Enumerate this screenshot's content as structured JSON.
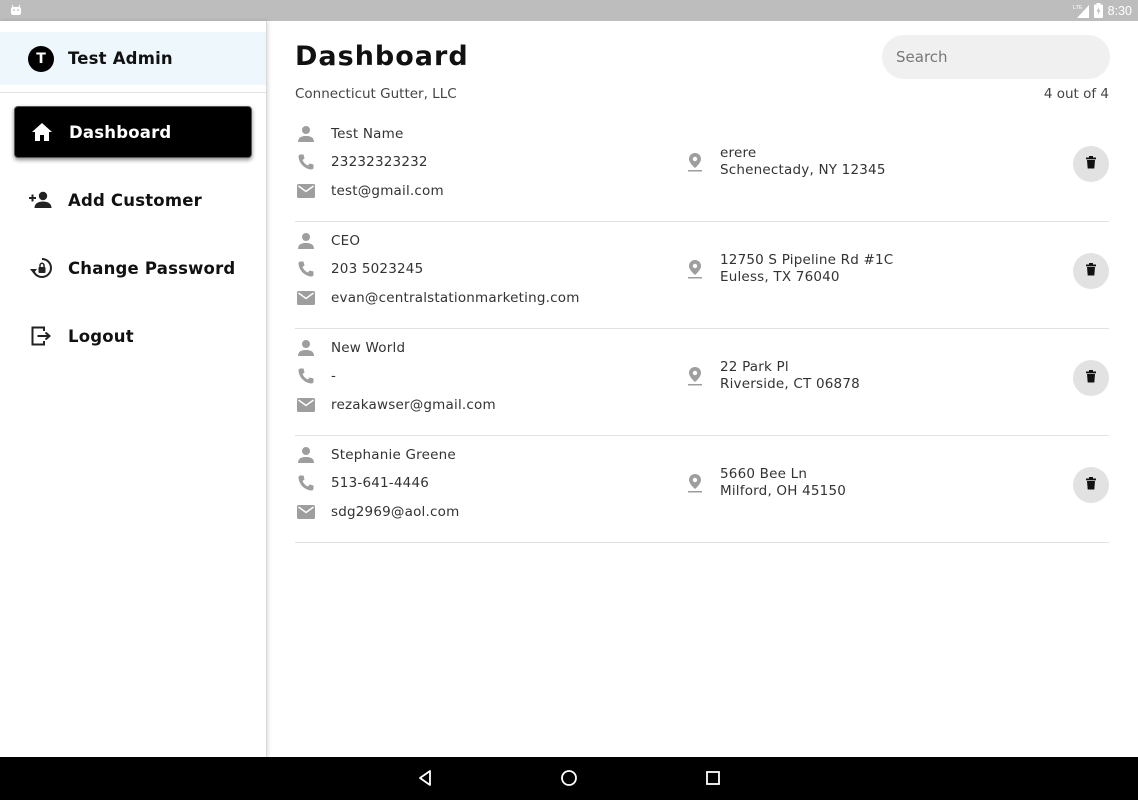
{
  "status_bar": {
    "time": "8:30",
    "network": "LTE",
    "icons": [
      "android-icon",
      "signal-icon",
      "battery-icon"
    ]
  },
  "sidebar": {
    "user": {
      "avatar_initial": "T",
      "name": "Test Admin"
    },
    "items": [
      {
        "label": "Dashboard",
        "icon": "home-icon",
        "active": true
      },
      {
        "label": "Add Customer",
        "icon": "person-add-icon",
        "active": false
      },
      {
        "label": "Change Password",
        "icon": "lock-reset-icon",
        "active": false
      },
      {
        "label": "Logout",
        "icon": "logout-icon",
        "active": false
      }
    ]
  },
  "main": {
    "title": "Dashboard",
    "search_placeholder": "Search",
    "company": "Connecticut Gutter, LLC",
    "count": "4 out of 4",
    "customers": [
      {
        "name": "Test Name",
        "phone": "23232323232",
        "email": "test@gmail.com",
        "address_line1": "erere",
        "address_line2": "Schenectady, NY 12345"
      },
      {
        "name": "CEO",
        "phone": "203 5023245",
        "email": "evan@centralstationmarketing.com",
        "address_line1": "12750 S Pipeline Rd #1C",
        "address_line2": "Euless, TX 76040"
      },
      {
        "name": "New World",
        "phone": "-",
        "email": "rezakawser@gmail.com",
        "address_line1": "22 Park Pl",
        "address_line2": "Riverside, CT 06878"
      },
      {
        "name": "Stephanie Greene",
        "phone": "513-641-4446",
        "email": "sdg2969@aol.com",
        "address_line1": "5660 Bee Ln",
        "address_line2": "Milford, OH 45150"
      }
    ]
  },
  "nav_bar": {
    "buttons": [
      "back-icon",
      "home-circle-icon",
      "recents-icon"
    ]
  },
  "colors": {
    "accent": "#000000",
    "sidebar_header_bg": "#eef7fc",
    "icon_gray": "#9e9e9e",
    "delete_bg": "#e2e2e2"
  }
}
